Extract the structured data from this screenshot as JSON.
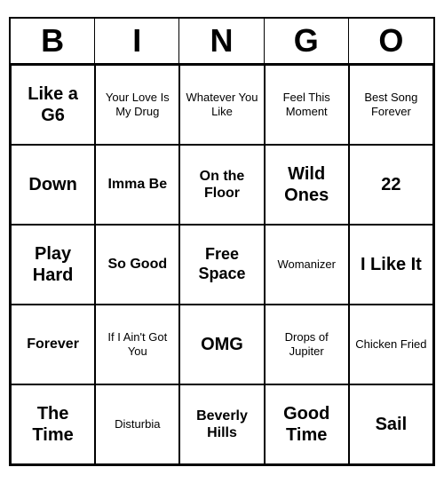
{
  "header": {
    "letters": [
      "B",
      "I",
      "N",
      "G",
      "O"
    ]
  },
  "cells": [
    {
      "text": "Like a G6",
      "size": "large"
    },
    {
      "text": "Your Love Is My Drug",
      "size": "small"
    },
    {
      "text": "Whatever You Like",
      "size": "small"
    },
    {
      "text": "Feel This Moment",
      "size": "small"
    },
    {
      "text": "Best Song Forever",
      "size": "small"
    },
    {
      "text": "Down",
      "size": "large"
    },
    {
      "text": "Imma Be",
      "size": "medium"
    },
    {
      "text": "On the Floor",
      "size": "medium"
    },
    {
      "text": "Wild Ones",
      "size": "large"
    },
    {
      "text": "22",
      "size": "large"
    },
    {
      "text": "Play Hard",
      "size": "large"
    },
    {
      "text": "So Good",
      "size": "medium"
    },
    {
      "text": "Free Space",
      "size": "free"
    },
    {
      "text": "Womanizer",
      "size": "small"
    },
    {
      "text": "I Like It",
      "size": "large"
    },
    {
      "text": "Forever",
      "size": "medium"
    },
    {
      "text": "If I Ain't Got You",
      "size": "small"
    },
    {
      "text": "OMG",
      "size": "large"
    },
    {
      "text": "Drops of Jupiter",
      "size": "small"
    },
    {
      "text": "Chicken Fried",
      "size": "small"
    },
    {
      "text": "The Time",
      "size": "large"
    },
    {
      "text": "Disturbia",
      "size": "small"
    },
    {
      "text": "Beverly Hills",
      "size": "medium"
    },
    {
      "text": "Good Time",
      "size": "large"
    },
    {
      "text": "Sail",
      "size": "large"
    }
  ]
}
